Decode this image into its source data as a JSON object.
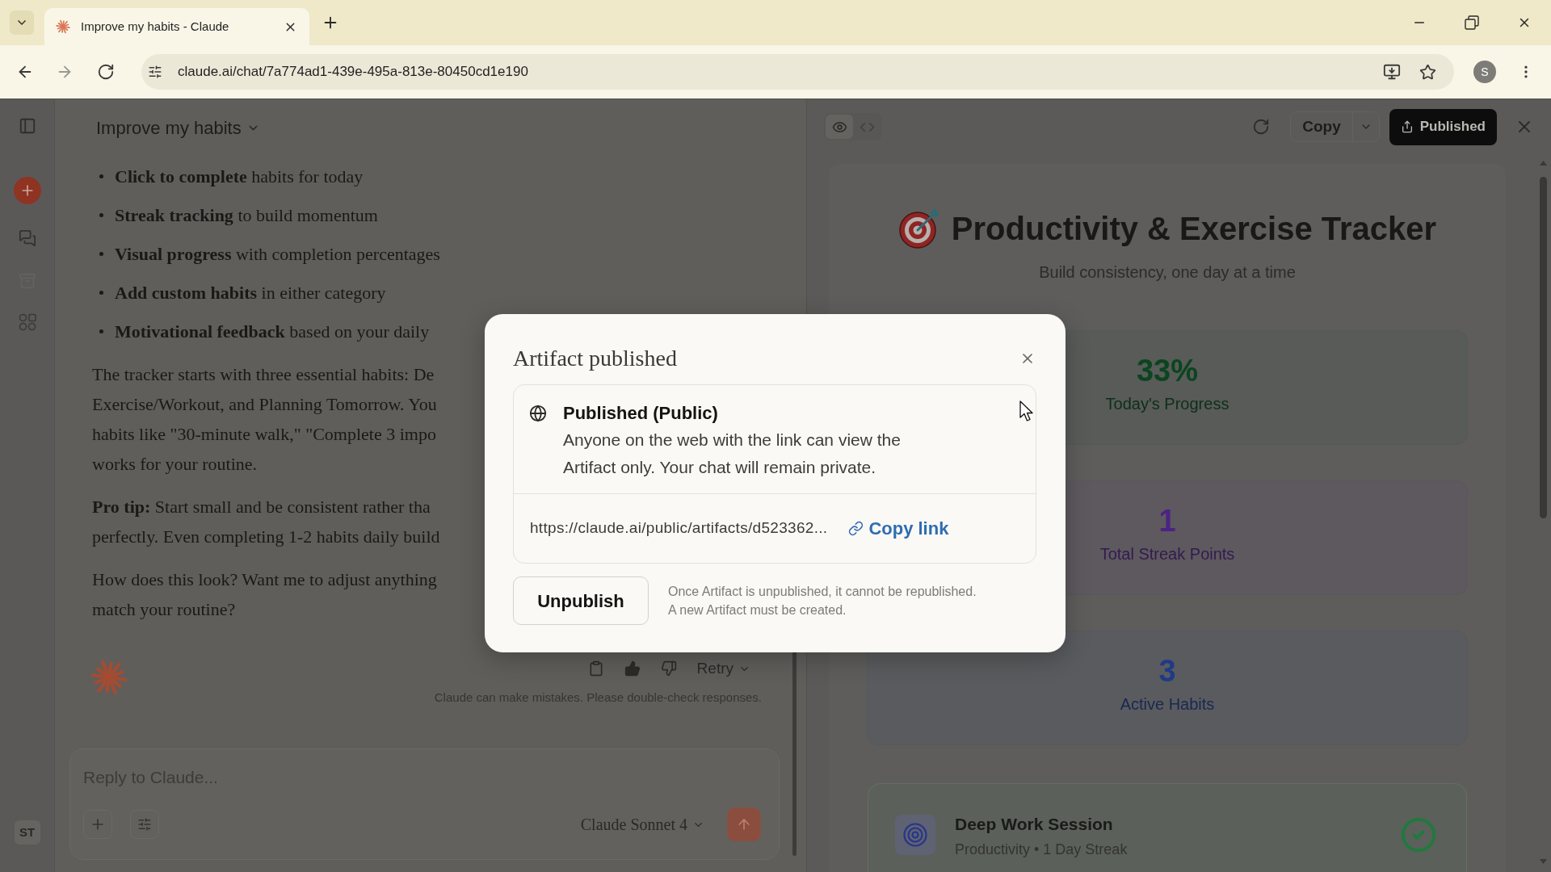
{
  "browser": {
    "tabs": [
      {
        "title": "Improve my habits - Claude",
        "selected": true
      }
    ],
    "address": "claude.ai/chat/7a774ad1-439e-495a-813e-80450cd1e190",
    "profile_initial": "S"
  },
  "sidebar": {
    "user_initials": "ST"
  },
  "chat": {
    "title": "Improve my habits",
    "bullets": [
      "**Click to complete** habits for today",
      "**Streak tracking** to build momentum",
      "**Visual progress** with completion percentages",
      "**Add custom habits** in either category",
      "**Motivational feedback** based on your daily"
    ],
    "paragraphs": [
      {
        "lines": [
          "The tracker starts with three essential habits: De",
          "Exercise/Workout, and Planning Tomorrow. You",
          "habits like \"30-minute walk,\" \"Complete 3 impo",
          "works for your routine."
        ]
      },
      {
        "lines": [
          "**Pro tip:** Start small and be consistent rather tha",
          "perfectly. Even completing 1-2 habits daily build"
        ]
      },
      {
        "lines": [
          "How does this look? Want me to adjust anything",
          "match your routine?"
        ]
      }
    ],
    "actions": {
      "liked": true,
      "retry": "Retry"
    },
    "disclaimer": "Claude can make mistakes. Please double-check responses.",
    "composer": {
      "placeholder": "Reply to Claude...",
      "model": "Claude Sonnet 4"
    }
  },
  "artifact": {
    "view_modes": [
      {
        "kind": "preview",
        "selected": true
      },
      {
        "kind": "code",
        "selected": false
      }
    ],
    "copy": "Copy",
    "published": "Published",
    "title": "Productivity & Exercise Tracker",
    "subtitle": "Build consistency, one day at a time",
    "stats": [
      {
        "value": "33%",
        "label": "Today's Progress",
        "color": "#0b4420"
      },
      {
        "value": "1",
        "label": "Total Streak Points",
        "color": "#4c2383"
      },
      {
        "value": "3",
        "label": "Active Habits",
        "color": "#1f3a86"
      }
    ],
    "habits": [
      {
        "name": "Deep Work Session",
        "meta": "Productivity • 1 Day Streak",
        "completed": true
      }
    ]
  },
  "dialog": {
    "title": "Artifact published",
    "status": "Published (Public)",
    "description": "Anyone on the web with the link can view the Artifact only. Your chat will remain private.",
    "url": "https://claude.ai/public/artifacts/d523362...",
    "copy_link": "Copy link",
    "unpublish": "Unpublish",
    "note": "Once Artifact is unpublished, it cannot be republished.\nA new Artifact must be created."
  }
}
